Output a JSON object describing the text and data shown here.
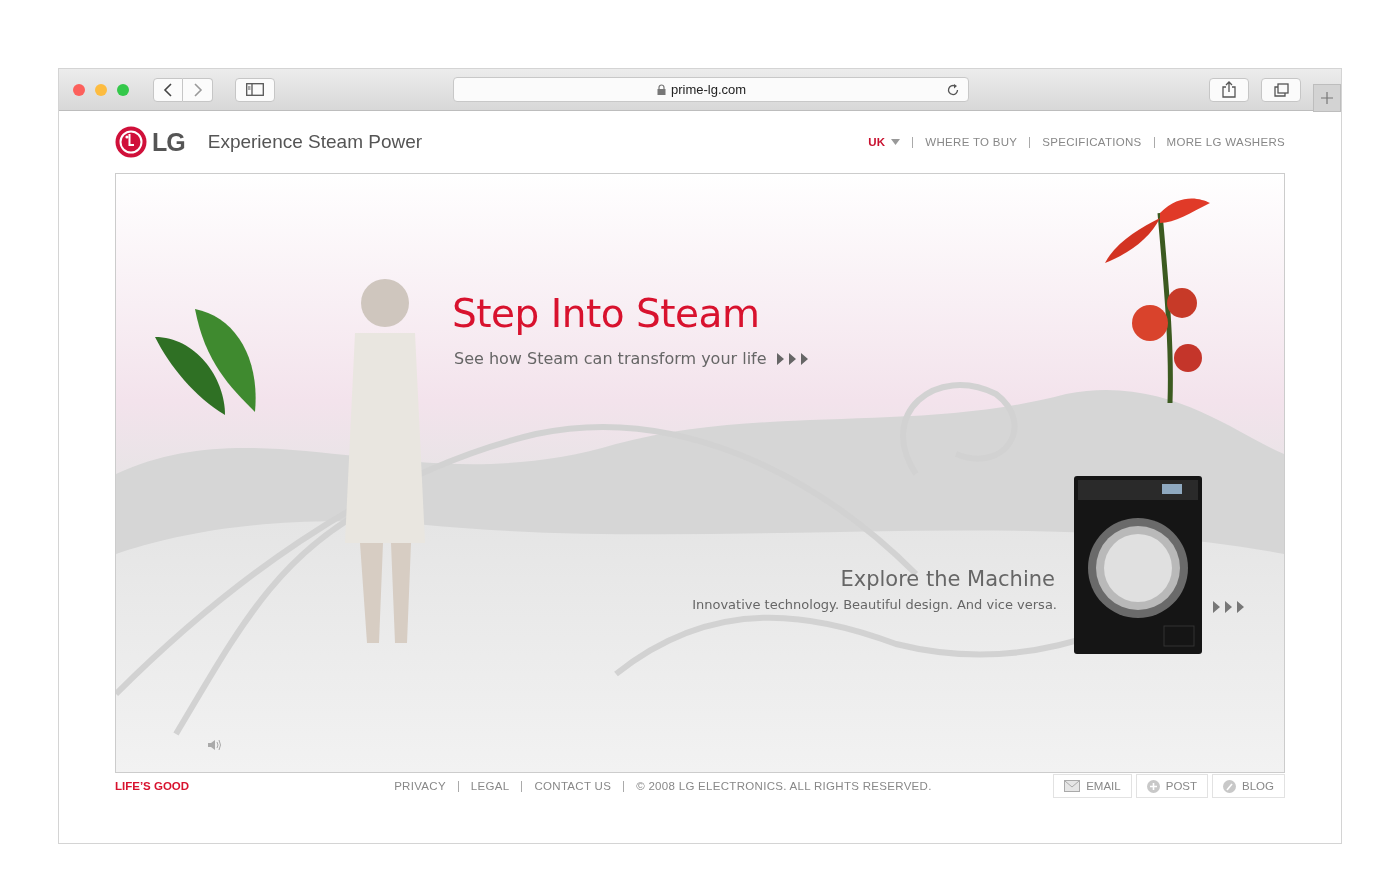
{
  "browser": {
    "url": "prime-lg.com"
  },
  "header": {
    "logo_text": "LG",
    "title": "Experience Steam Power"
  },
  "nav": [
    {
      "label": "UK",
      "kind": "dropdown",
      "selected": true
    },
    {
      "label": "WHERE TO BUY",
      "kind": "link",
      "selected": false
    },
    {
      "label": "SPECIFICATIONS",
      "kind": "link",
      "selected": false
    },
    {
      "label": "MORE LG WASHERS",
      "kind": "link",
      "selected": false
    }
  ],
  "hero": {
    "headline": "Step Into Steam",
    "subline": "See how Steam can transform your life",
    "machine_title": "Explore the Machine",
    "machine_subline": "Innovative technology. Beautiful design. And vice versa."
  },
  "footer": {
    "tagline": "LIFE’S GOOD",
    "links": [
      "PRIVACY",
      "LEGAL",
      "CONTACT US"
    ],
    "copyright": "© 2008 LG ELECTRONICS. ALL RIGHTS RESERVED.",
    "share": [
      {
        "label": "EMAIL",
        "kind": "email"
      },
      {
        "label": "POST",
        "kind": "post"
      },
      {
        "label": "BLOG",
        "kind": "blog"
      }
    ]
  }
}
